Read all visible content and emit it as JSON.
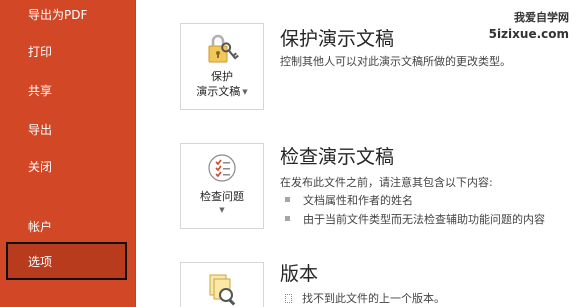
{
  "sidebar": {
    "items": [
      {
        "label": "导出为PDF"
      },
      {
        "label": "打印"
      },
      {
        "label": "共享"
      },
      {
        "label": "导出"
      },
      {
        "label": "关闭"
      },
      {
        "label": "帐户"
      },
      {
        "label": "选项"
      }
    ],
    "selected": "选项",
    "colors": {
      "background": "#d24726",
      "selected": "#b83b1d"
    }
  },
  "protect": {
    "card_label_1": "保护",
    "card_label_2": "演示文稿",
    "title": "保护演示文稿",
    "description": "控制其他人可以对此演示文稿所做的更改类型。",
    "icon": "lock-key-icon"
  },
  "inspect": {
    "card_label": "检查问题",
    "title": "检查演示文稿",
    "description": "在发布此文件之前，请注意其包含以下内容:",
    "bullets": [
      "文档属性和作者的姓名",
      "由于当前文件类型而无法检查辅助功能问题的内容"
    ],
    "icon": "checklist-icon"
  },
  "versions": {
    "title": "版本",
    "items": [
      "找不到此文件的上一个版本。"
    ],
    "icon": "documents-magnifier-icon"
  },
  "watermark": {
    "line1": "我爱自学网",
    "line2": "5izixue.com"
  }
}
